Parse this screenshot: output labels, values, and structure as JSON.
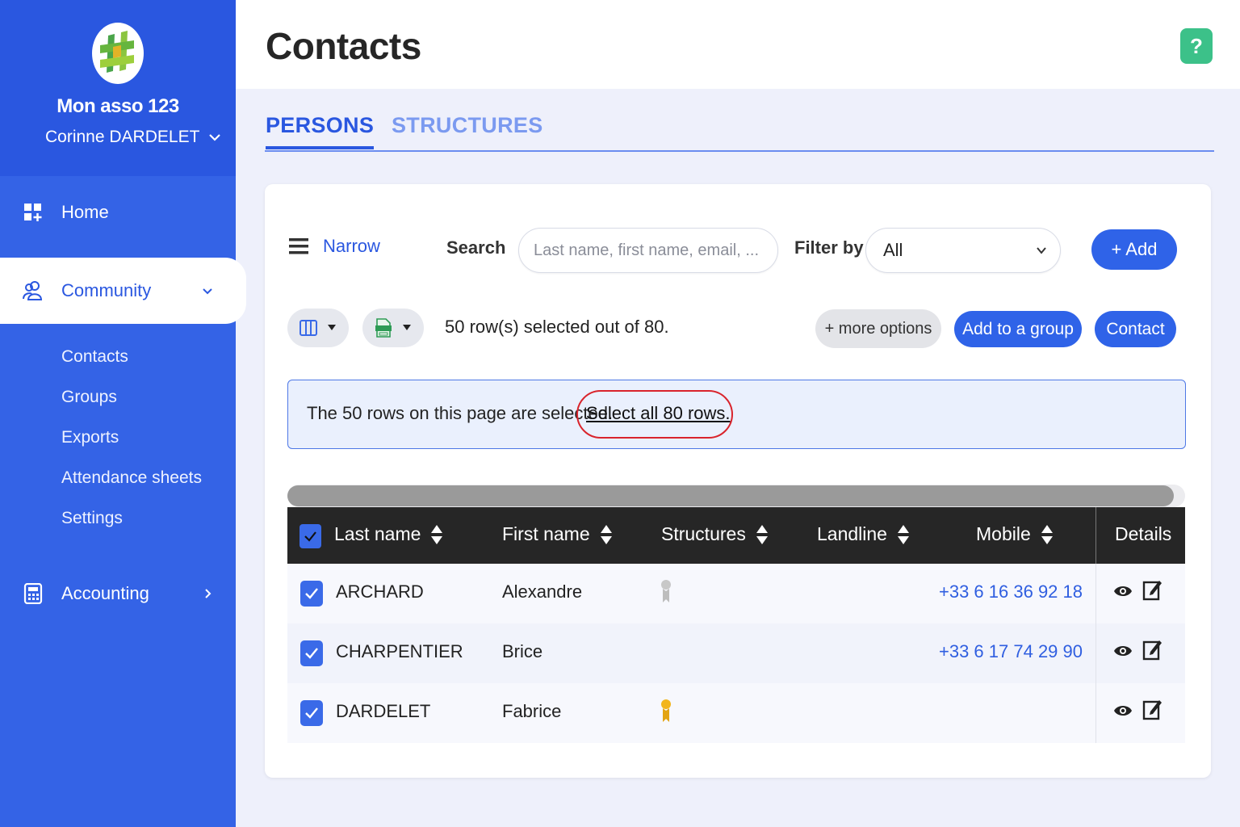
{
  "sidebar": {
    "org_name": "Mon asso 123",
    "user_name": "Corinne DARDELET",
    "nav": {
      "home": "Home",
      "community": "Community",
      "accounting": "Accounting"
    },
    "sub_items": [
      "Contacts",
      "Groups",
      "Exports",
      "Attendance sheets",
      "Settings"
    ]
  },
  "header": {
    "title": "Contacts",
    "help": "?"
  },
  "tabs": {
    "persons": "PERSONS",
    "structures": "STRUCTURES"
  },
  "toolbar": {
    "narrow": "Narrow",
    "search_label": "Search",
    "search_placeholder": "Last name, first name, email, ...",
    "filter_label": "Filter by",
    "filter_value": "All",
    "add_label": "+ Add",
    "selected_count": "50 row(s) selected out of 80.",
    "more_options": "+ more options",
    "add_to_group": "Add to a group",
    "contact": "Contact"
  },
  "banner": {
    "text": "The 50 rows on this page are selected.",
    "link": "Select all 80 rows."
  },
  "table": {
    "headers": {
      "last_name": "Last name",
      "first_name": "First name",
      "structures": "Structures",
      "landline": "Landline",
      "mobile": "Mobile",
      "details": "Details"
    },
    "rows": [
      {
        "last_name": "ARCHARD",
        "first_name": "Alexandre",
        "structure_badge": "grey",
        "landline": "",
        "mobile": "+33 6 16 36 92 18",
        "checked": true
      },
      {
        "last_name": "CHARPENTIER",
        "first_name": "Brice",
        "structure_badge": "",
        "landline": "",
        "mobile": "+33 6 17 74 29 90",
        "checked": true
      },
      {
        "last_name": "DARDELET",
        "first_name": "Fabrice",
        "structure_badge": "gold",
        "landline": "",
        "mobile": "",
        "checked": true
      }
    ]
  },
  "colors": {
    "sidebar": "#3463e6",
    "primary": "#2f63e8",
    "help": "#3cc189",
    "highlight_circle": "#d9242c"
  }
}
